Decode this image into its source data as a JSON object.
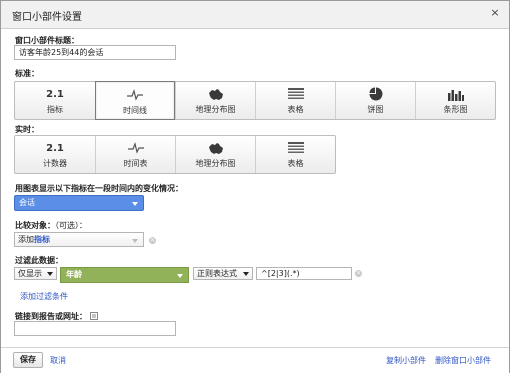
{
  "dialog": {
    "title": "窗口小部件设置",
    "close_glyph": "×"
  },
  "widget_title": {
    "label": "窗口小部件标题：",
    "value": "访客年龄25到44的会话"
  },
  "standard": {
    "label": "标准：",
    "buttons": [
      {
        "icon_text": "2.1",
        "label": "指标"
      },
      {
        "icon": "timeline-icon",
        "label": "时间线"
      },
      {
        "icon": "map-icon",
        "label": "地理分布图"
      },
      {
        "icon": "table-icon",
        "label": "表格"
      },
      {
        "icon": "pie-icon",
        "label": "饼图"
      },
      {
        "icon": "bar-chart-icon",
        "label": "条形图"
      }
    ],
    "selected": 1
  },
  "realtime": {
    "label": "实时：",
    "buttons": [
      {
        "icon_text": "2.1",
        "label": "计数器"
      },
      {
        "icon": "timeline-icon",
        "label": "时间表"
      },
      {
        "icon": "map-icon",
        "label": "地理分布图"
      },
      {
        "icon": "table-icon",
        "label": "表格"
      }
    ]
  },
  "metric": {
    "label": "用图表显示以下指标在一段时间内的变化情况：",
    "value": "会话"
  },
  "compare": {
    "label": "比较对象：",
    "optional": "（可选）：",
    "add_prefix": "添加",
    "add_bold": "指标"
  },
  "filter": {
    "label": "过滤此数据：",
    "mode": "仅显示",
    "dimension": "年龄",
    "match_type": "正则表达式",
    "expression": "^[2|3](.*)",
    "add_filter": "添加过滤条件"
  },
  "link": {
    "label": "链接到报告或网址：",
    "value": ""
  },
  "footer": {
    "save": "保存",
    "cancel": "取消",
    "clone": "复制小部件",
    "delete": "删除窗口小部件"
  },
  "colors": {
    "accent_blue": "#5b8ee6",
    "filter_green": "#92b25a",
    "link_blue": "#2f56c4"
  }
}
